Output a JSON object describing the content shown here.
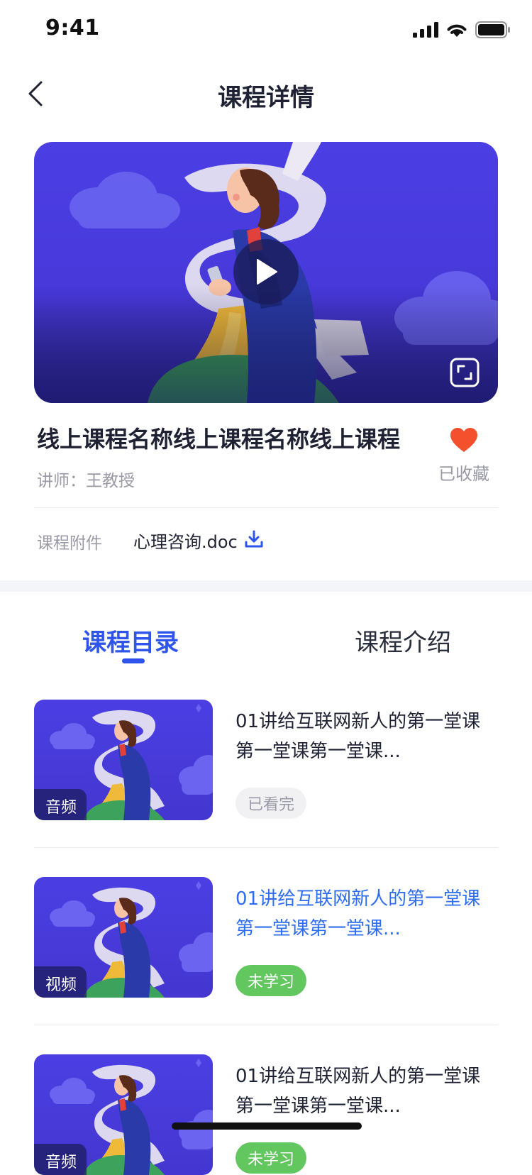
{
  "status_bar": {
    "time": "9:41"
  },
  "nav": {
    "title": "课程详情"
  },
  "course": {
    "title": "线上课程名称线上课程名称线上课程",
    "teacher": "讲师：王教授",
    "favorite_label": "已收藏",
    "attachment_label": "课程附件",
    "attachment_file": "心理咨询.doc"
  },
  "tabs": [
    {
      "label": "课程目录",
      "active": true
    },
    {
      "label": "课程介绍",
      "active": false
    }
  ],
  "lessons": [
    {
      "type": "音频",
      "title_line1": "01讲给互联网新人的第一堂课",
      "title_line2": "第一堂课第一堂课...",
      "status": "已看完"
    },
    {
      "type": "视频",
      "title_line1": "01讲给互联网新人的第一堂课",
      "title_line2": "第一堂课第一堂课...",
      "status": "未学习"
    },
    {
      "type": "音频",
      "title_line1": "01讲给互联网新人的第一堂课",
      "title_line2": "第一堂课第一堂课...",
      "status": "未学习"
    }
  ],
  "colors": {
    "accent": "#2f54eb",
    "active_lesson": "#2f6df0",
    "heart": "#f5502d",
    "badge_new": "#62c75f",
    "video_bg": "#4b3fe4"
  }
}
